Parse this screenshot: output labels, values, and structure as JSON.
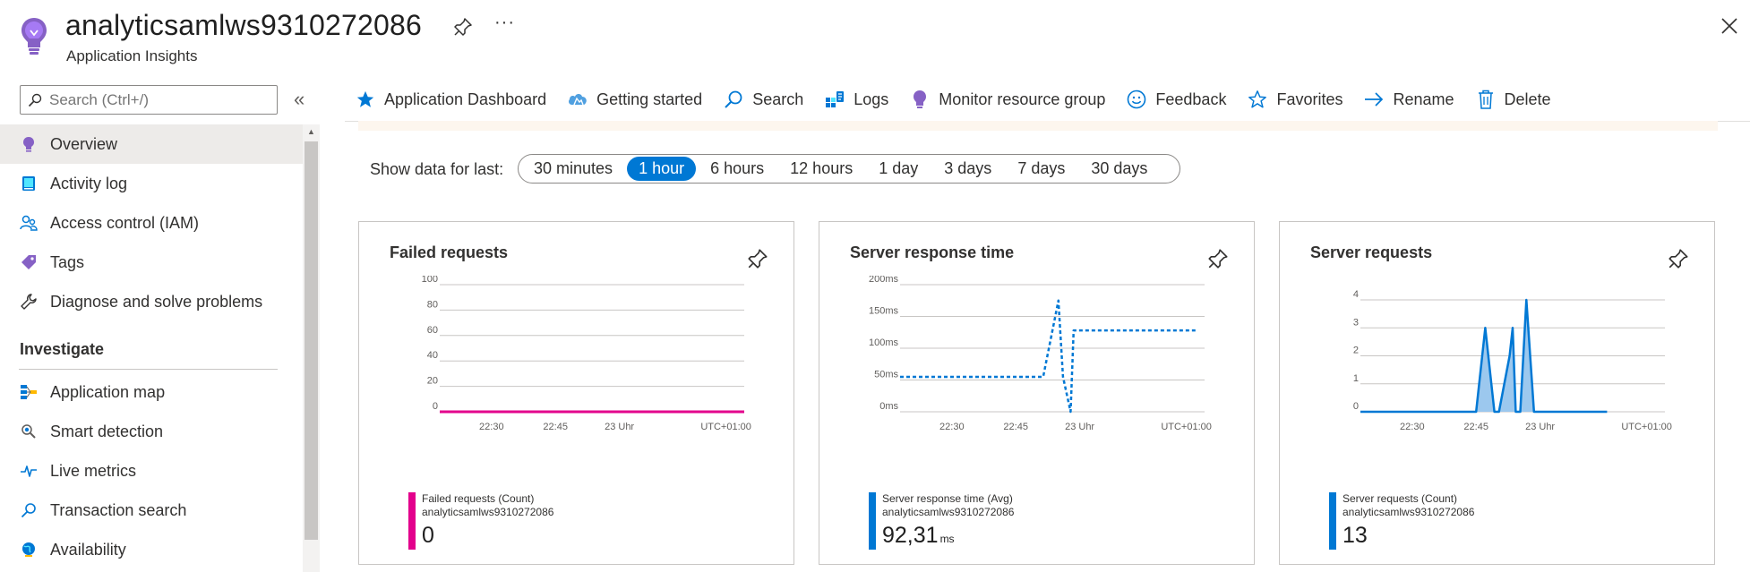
{
  "header": {
    "title": "analyticsamlws9310272086",
    "subtitle": "Application Insights",
    "more_label": "···"
  },
  "sidebar": {
    "search_placeholder": "Search (Ctrl+/)",
    "collapse_label": "«",
    "items": [
      {
        "label": "Overview",
        "icon": "lightbulb-icon",
        "active": true
      },
      {
        "label": "Activity log",
        "icon": "activity-log-icon"
      },
      {
        "label": "Access control (IAM)",
        "icon": "people-icon"
      },
      {
        "label": "Tags",
        "icon": "tag-icon"
      },
      {
        "label": "Diagnose and solve problems",
        "icon": "wrench-icon"
      }
    ],
    "section_investigate": "Investigate",
    "investigate_items": [
      {
        "label": "Application map",
        "icon": "app-map-icon"
      },
      {
        "label": "Smart detection",
        "icon": "smart-detection-icon"
      },
      {
        "label": "Live metrics",
        "icon": "pulse-icon"
      },
      {
        "label": "Transaction search",
        "icon": "search-icon"
      },
      {
        "label": "Availability",
        "icon": "globe-icon"
      }
    ]
  },
  "toolbar": {
    "items": [
      {
        "label": "Application Dashboard",
        "icon": "star-filled-icon"
      },
      {
        "label": "Getting started",
        "icon": "cloud-icon"
      },
      {
        "label": "Search",
        "icon": "search-icon"
      },
      {
        "label": "Logs",
        "icon": "logs-icon"
      },
      {
        "label": "Monitor resource group",
        "icon": "lightbulb-icon"
      },
      {
        "label": "Feedback",
        "icon": "smiley-icon"
      },
      {
        "label": "Favorites",
        "icon": "star-outline-icon"
      },
      {
        "label": "Rename",
        "icon": "arrow-right-icon"
      },
      {
        "label": "Delete",
        "icon": "trash-icon"
      }
    ]
  },
  "time_range": {
    "label": "Show data for last:",
    "options": [
      "30 minutes",
      "1 hour",
      "6 hours",
      "12 hours",
      "1 day",
      "3 days",
      "7 days",
      "30 days"
    ],
    "selected": "1 hour"
  },
  "colors": {
    "accent": "#0078d4",
    "failed": "#e3008c",
    "server": "#0078d4",
    "lightbulb": "#8661c5"
  },
  "cards": [
    {
      "title": "Failed requests",
      "legend_name": "Failed requests (Count)",
      "legend_resource": "analyticsamlws9310272086",
      "value": "0",
      "unit": "",
      "color": "#e3008c"
    },
    {
      "title": "Server response time",
      "legend_name": "Server response time (Avg)",
      "legend_resource": "analyticsamlws9310272086",
      "value": "92,31",
      "unit": "ms",
      "color": "#0078d4"
    },
    {
      "title": "Server requests",
      "legend_name": "Server requests (Count)",
      "legend_resource": "analyticsamlws9310272086",
      "value": "13",
      "unit": "",
      "color": "#0078d4"
    }
  ],
  "chart_data": [
    {
      "type": "line",
      "title": "Failed requests",
      "y_ticks": [
        "100",
        "80",
        "60",
        "40",
        "20",
        "0"
      ],
      "ylim": [
        0,
        100
      ],
      "x_ticks": [
        "22:30",
        "22:45",
        "23 Uhr",
        "UTC+01:00"
      ],
      "series": [
        {
          "name": "Failed requests (Count)",
          "x": [
            0,
            1
          ],
          "values": [
            0,
            0
          ]
        }
      ]
    },
    {
      "type": "line",
      "title": "Server response time",
      "y_ticks": [
        "200ms",
        "150ms",
        "100ms",
        "50ms",
        "0ms"
      ],
      "ylim": [
        0,
        200
      ],
      "x_ticks": [
        "22:30",
        "22:45",
        "23 Uhr",
        "UTC+01:00"
      ],
      "series": [
        {
          "name": "Server response time (Avg)",
          "x": [
            0,
            0.47,
            0.52,
            0.535,
            0.56,
            0.57,
            0.97
          ],
          "values": [
            55,
            55,
            175,
            55,
            0,
            128,
            128
          ]
        }
      ]
    },
    {
      "type": "area",
      "title": "Server requests",
      "y_ticks": [
        "4",
        "3",
        "2",
        "1",
        "0"
      ],
      "ylim": [
        0,
        4
      ],
      "x_ticks": [
        "22:30",
        "22:45",
        "23 Uhr",
        "UTC+01:00"
      ],
      "series": [
        {
          "name": "Server requests (Count)",
          "x": [
            0,
            0.38,
            0.41,
            0.44,
            0.445,
            0.455,
            0.49,
            0.5,
            0.51,
            0.525,
            0.545,
            0.57,
            0.59,
            0.65,
            0.81
          ],
          "values": [
            0,
            0,
            3,
            0,
            0,
            0,
            2,
            3,
            0,
            0,
            4,
            0,
            0,
            0,
            0
          ]
        }
      ]
    }
  ]
}
